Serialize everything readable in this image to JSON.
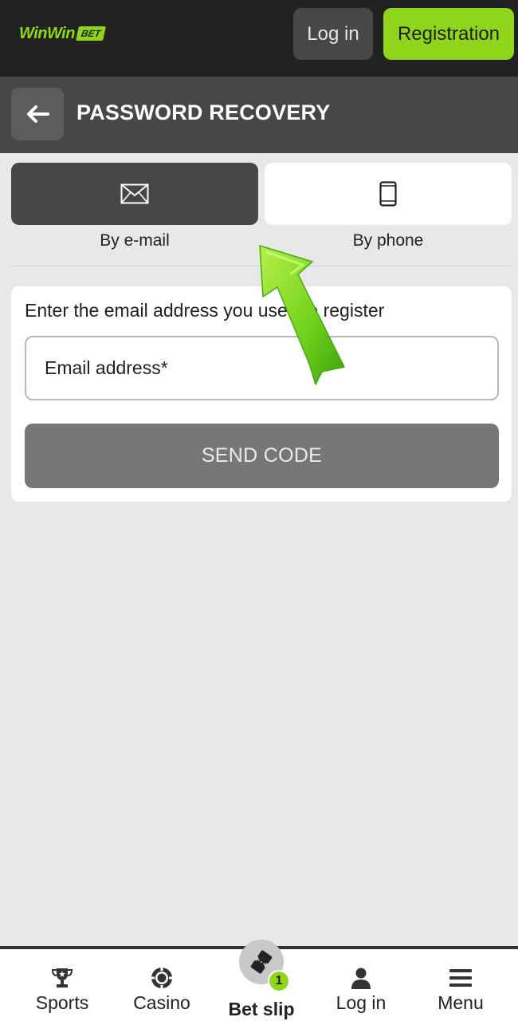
{
  "header": {
    "logo_text": "WinWin",
    "logo_badge": "BET",
    "login_label": "Log in",
    "register_label": "Registration"
  },
  "page": {
    "title": "PASSWORD RECOVERY",
    "back_icon": "arrow-left-icon"
  },
  "methods": [
    {
      "label": "By e-mail",
      "icon": "envelope-icon",
      "selected": true
    },
    {
      "label": "By phone",
      "icon": "smartphone-icon",
      "selected": false
    }
  ],
  "form": {
    "instruction": "Enter the email address you used to register",
    "email_placeholder": "Email address*",
    "email_value": "",
    "send_label": "SEND CODE"
  },
  "bottom_nav": [
    {
      "label": "Sports",
      "icon": "trophy-icon"
    },
    {
      "label": "Casino",
      "icon": "casino-chip-icon"
    },
    {
      "label": "Bet slip",
      "icon": "ticket-icon",
      "badge": "1"
    },
    {
      "label": "Log in",
      "icon": "user-icon"
    },
    {
      "label": "Menu",
      "icon": "hamburger-icon"
    }
  ],
  "colors": {
    "accent": "#8fd61a",
    "dark": "#222222",
    "panel": "#474747",
    "button_disabled": "#777777"
  }
}
